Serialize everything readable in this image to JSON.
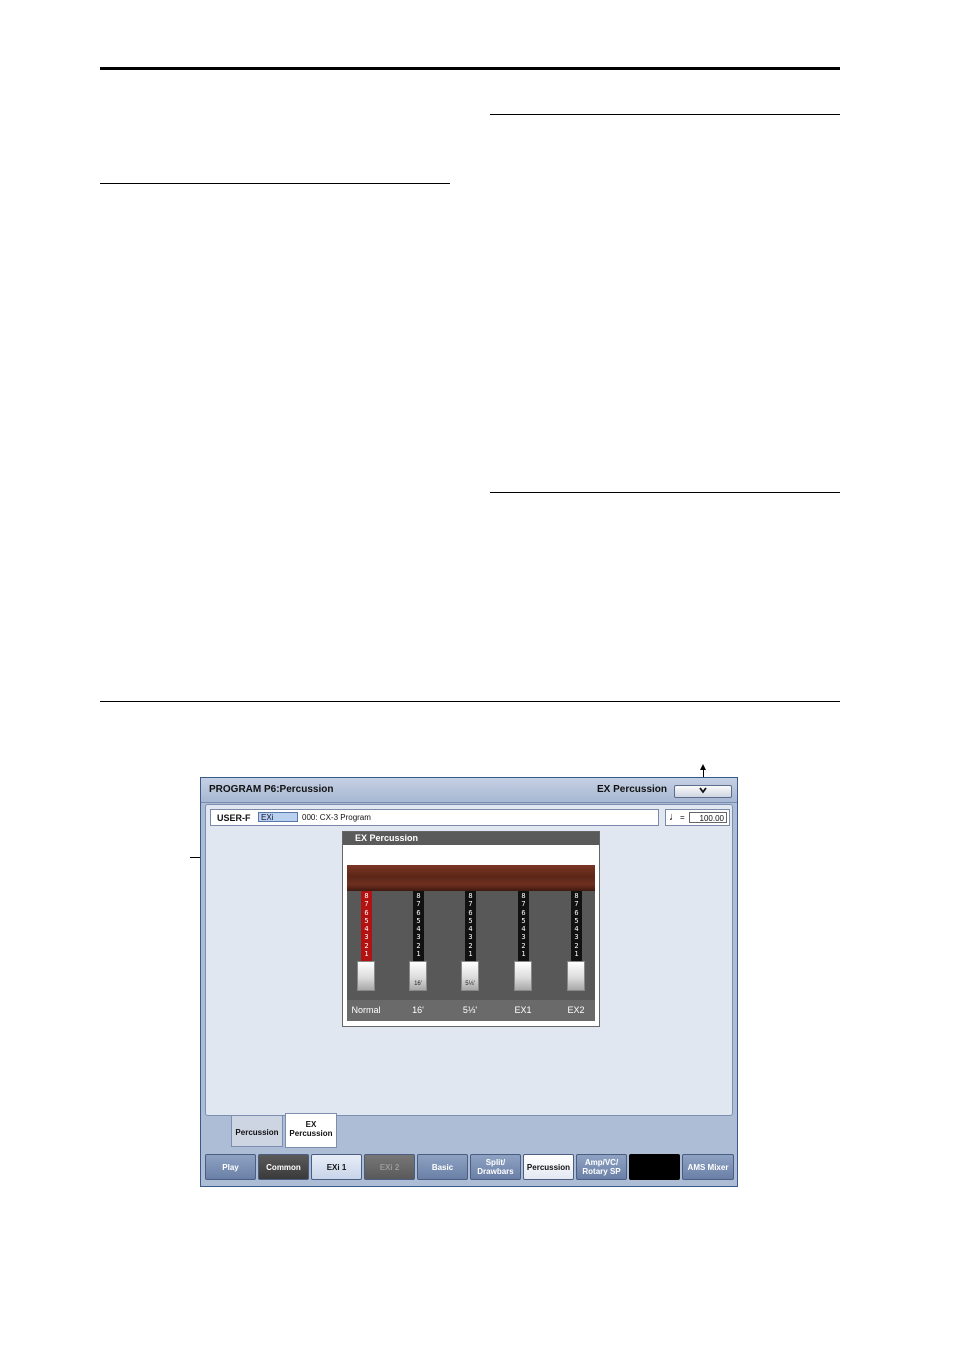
{
  "screen": {
    "title": "PROGRAM P6:Percussion",
    "page_label": "EX Percussion",
    "menu_icon": "chevron-down-icon",
    "program": {
      "bank": "USER-F",
      "type": "EXi",
      "name": "000: CX-3 Program"
    },
    "tempo": {
      "note_symbol": "♩",
      "equals": "=",
      "value": "100.00"
    },
    "panel": {
      "title": "EX Percussion",
      "scale": "8 7 6 5 4 3 2 1",
      "drawbars": [
        {
          "label": "Normal",
          "cap": "",
          "color": "#b31212"
        },
        {
          "label": "16'",
          "cap": "16'",
          "color": "#111111"
        },
        {
          "label": "5⅓'",
          "cap": "5⅓'",
          "color": "#111111"
        },
        {
          "label": "EX1",
          "cap": "",
          "color": "#111111"
        },
        {
          "label": "EX2",
          "cap": "",
          "color": "#111111"
        }
      ]
    },
    "subtabs": [
      {
        "line1": "Percussion",
        "line2": ""
      },
      {
        "line1": "EX",
        "line2": "Percussion"
      }
    ],
    "tabs": [
      {
        "line1": "Play",
        "line2": ""
      },
      {
        "line1": "Common",
        "line2": ""
      },
      {
        "line1": "EXi 1",
        "line2": ""
      },
      {
        "line1": "EXi 2",
        "line2": ""
      },
      {
        "line1": "Basic",
        "line2": ""
      },
      {
        "line1": "Split/",
        "line2": "Drawbars"
      },
      {
        "line1": "Percussion",
        "line2": ""
      },
      {
        "line1": "Amp/VC/",
        "line2": "Rotary SP"
      },
      {
        "line1": "",
        "line2": ""
      },
      {
        "line1": "AMS Mixer",
        "line2": ""
      }
    ]
  }
}
